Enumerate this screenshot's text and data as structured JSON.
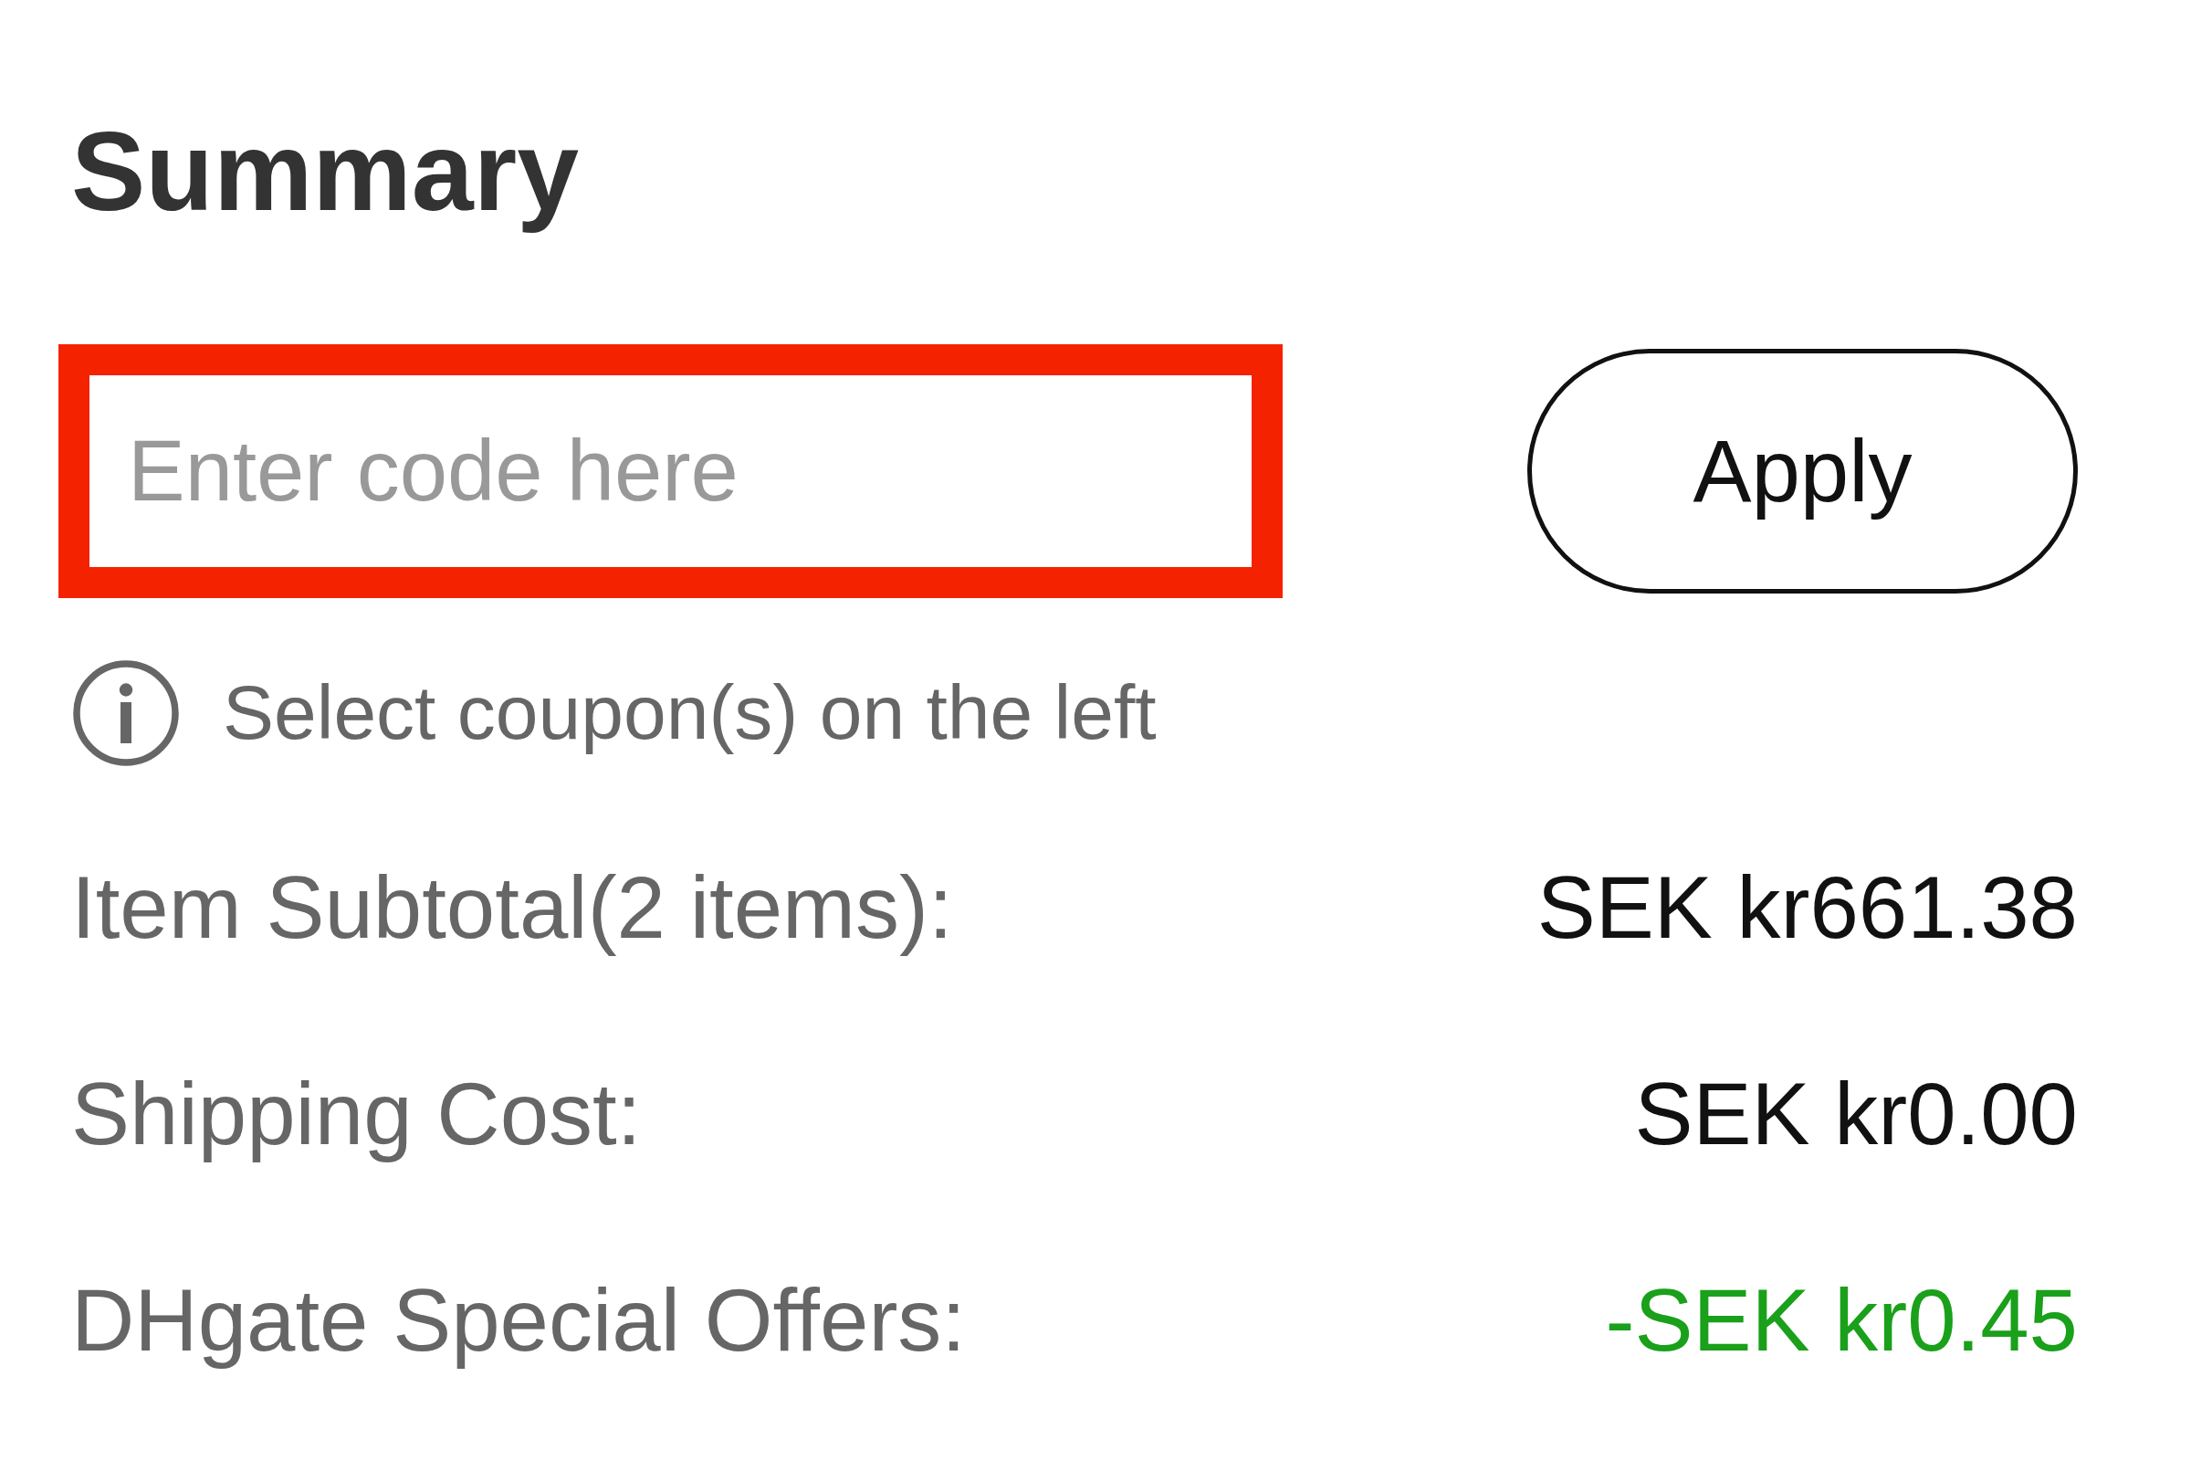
{
  "title": "Summary",
  "coupon": {
    "placeholder": "Enter code here",
    "highlighted": true,
    "button": "Apply",
    "hint": "Select coupon(s) on the left"
  },
  "rows": [
    {
      "label": "Item Subtotal(2 items):",
      "value": "SEK kr661.38",
      "kind": "amount"
    },
    {
      "label": "Shipping Cost:",
      "value": "SEK kr0.00",
      "kind": "amount"
    },
    {
      "label": "DHgate Special Offers:",
      "value": "-SEK kr0.45",
      "kind": "discount"
    }
  ]
}
